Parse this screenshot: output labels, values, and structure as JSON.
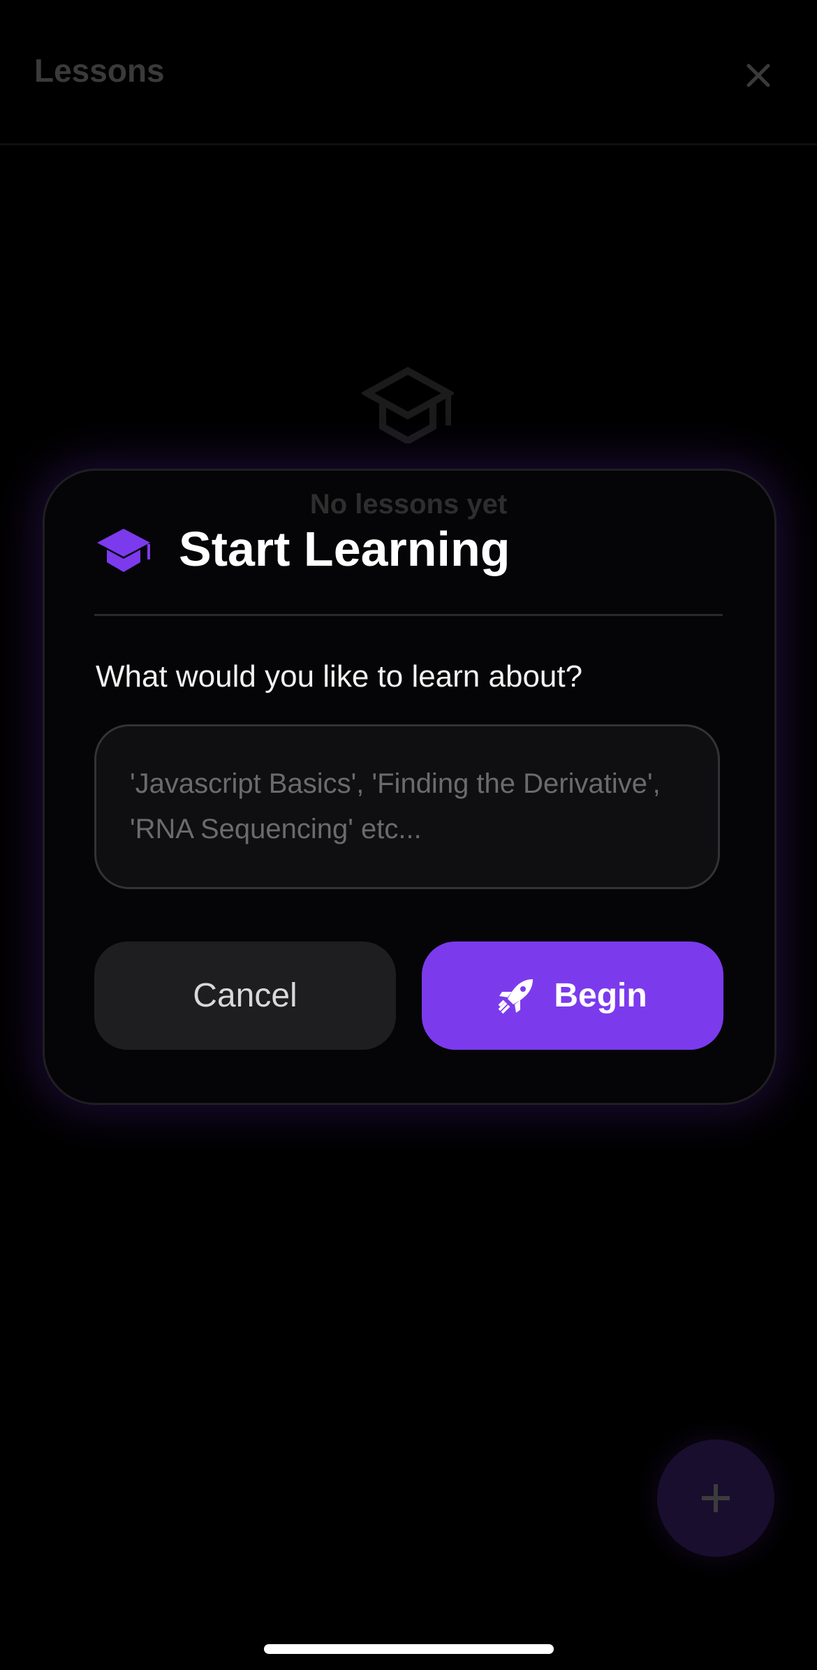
{
  "header": {
    "title": "Lessons",
    "close_icon": "close-icon"
  },
  "empty_state": {
    "icon": "graduation-cap-icon",
    "text": "No lessons yet"
  },
  "modal": {
    "icon": "graduation-cap-icon",
    "title": "Start Learning",
    "question": "What would you like to learn about?",
    "input": {
      "value": "",
      "placeholder": "'Javascript Basics', 'Finding the Derivative', 'RNA Sequencing' etc..."
    },
    "cancel_label": "Cancel",
    "begin_label": "Begin",
    "begin_icon": "rocket-icon",
    "accent_color": "#7c3aed"
  },
  "fab": {
    "icon": "plus-icon"
  }
}
